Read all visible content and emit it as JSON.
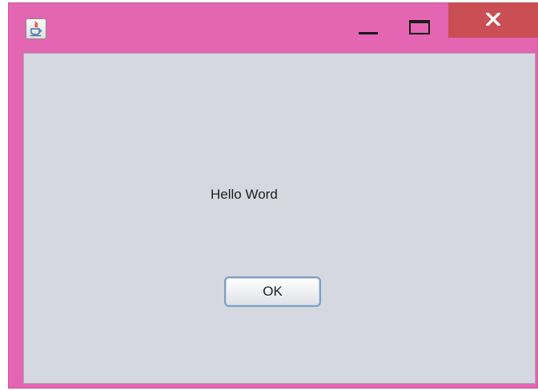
{
  "window": {
    "frame_color": "#e465b2",
    "close_color": "#c94f55",
    "content_bg": "#d5d8e0",
    "app_icon": "java-icon",
    "controls": {
      "minimize_icon": "minimize-icon",
      "maximize_icon": "maximize-icon",
      "close_icon": "close-icon"
    }
  },
  "content": {
    "message": "Hello Word",
    "ok_label": "OK"
  }
}
